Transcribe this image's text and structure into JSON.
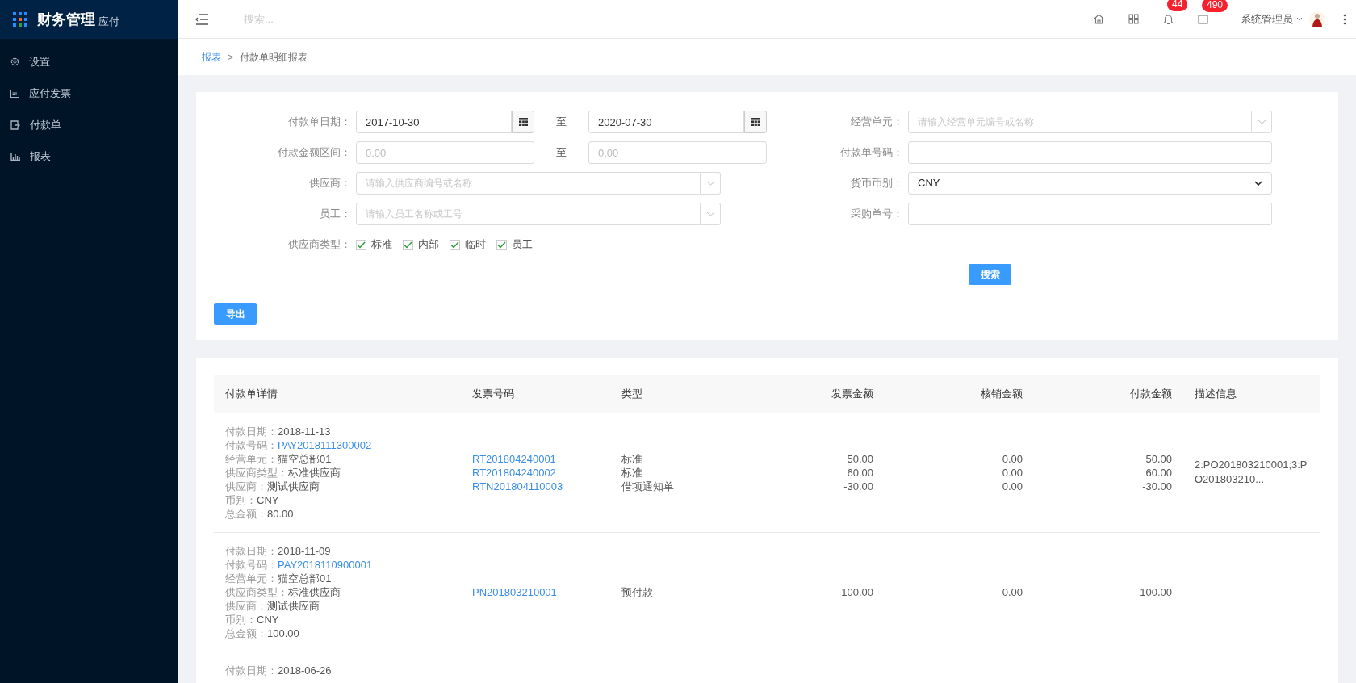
{
  "sidebar": {
    "brand": "财务管理",
    "brand_sub": "应付",
    "items": [
      {
        "label": "设置",
        "selected": false
      },
      {
        "label": "应付发票",
        "selected": false
      },
      {
        "label": "付款单",
        "selected": false
      },
      {
        "label": "报表",
        "selected": false
      }
    ]
  },
  "topbar": {
    "search_placeholder": "搜索...",
    "icons": [
      {
        "kind": "home"
      },
      {
        "kind": "grid"
      },
      {
        "kind": "bell",
        "badge": "44"
      },
      {
        "kind": "box",
        "badge": "490"
      }
    ],
    "user": "系统管理员"
  },
  "breadcrumb": {
    "items": [
      {
        "label": "报表",
        "kind": "link"
      },
      {
        "label": "付款单明细报表",
        "kind": "current"
      }
    ],
    "separator": ">"
  },
  "form": {
    "left_rows": [
      {
        "kind": "date_range",
        "label": "付款单日期：",
        "from": "2017-10-30",
        "to": "2020-07-30",
        "separator": "至"
      },
      {
        "kind": "number_range",
        "label": "付款金额区间：",
        "from_placeholder": "0.00",
        "to_placeholder": "0.00",
        "separator": "至"
      },
      {
        "kind": "combo",
        "label": "供应商：",
        "placeholder": "请输入供应商编号或名称"
      },
      {
        "kind": "combo",
        "label": "员工：",
        "placeholder": "请输入员工名称或工号"
      },
      {
        "kind": "checks",
        "label": "供应商类型：",
        "options": [
          {
            "label": "标准",
            "checked": true
          },
          {
            "label": "内部",
            "checked": true
          },
          {
            "label": "临时",
            "checked": true
          },
          {
            "label": "员工",
            "checked": true
          }
        ]
      }
    ],
    "right_rows": [
      {
        "kind": "combo",
        "label": "经营单元：",
        "placeholder": "请输入经营单元编号或名称"
      },
      {
        "kind": "text",
        "label": "付款单号码："
      },
      {
        "kind": "select",
        "label": "货币币别：",
        "value": "CNY"
      },
      {
        "kind": "text",
        "label": "采购单号："
      }
    ],
    "search_button": "搜索",
    "export_button": "导出"
  },
  "table": {
    "columns": [
      "付款单详情",
      "发票号码",
      "类型",
      "发票金额",
      "核销金额",
      "付款金额",
      "描述信息"
    ],
    "rows": [
      {
        "details": [
          {
            "label": "付款日期：",
            "value": "2018-11-13",
            "kind": "text"
          },
          {
            "label": "付款号码：",
            "value": "PAY2018111300002",
            "kind": "link"
          },
          {
            "label": "经营单元：",
            "value": "猫空总部01",
            "kind": "text"
          },
          {
            "label": "供应商类型：",
            "value": "标准供应商",
            "kind": "text"
          },
          {
            "label": "供应商：",
            "value": "测试供应商",
            "kind": "text"
          },
          {
            "label": "币别：",
            "value": "CNY",
            "kind": "text"
          },
          {
            "label": "总金额：",
            "value": "80.00",
            "kind": "text"
          }
        ],
        "invoices": [
          {
            "number": "RT201804240001",
            "type": "标准",
            "invoice_amount": "50.00",
            "writeoff_amount": "0.00",
            "payment_amount": "50.00"
          },
          {
            "number": "RT201804240002",
            "type": "标准",
            "invoice_amount": "60.00",
            "writeoff_amount": "0.00",
            "payment_amount": "60.00"
          },
          {
            "number": "RTN201804110003",
            "type": "借项通知单",
            "invoice_amount": "-30.00",
            "writeoff_amount": "0.00",
            "payment_amount": "-30.00"
          }
        ],
        "description": "2:PO201803210001;3:PO201803210..."
      },
      {
        "details": [
          {
            "label": "付款日期：",
            "value": "2018-11-09",
            "kind": "text"
          },
          {
            "label": "付款号码：",
            "value": "PAY2018110900001",
            "kind": "link"
          },
          {
            "label": "经营单元：",
            "value": "猫空总部01",
            "kind": "text"
          },
          {
            "label": "供应商类型：",
            "value": "标准供应商",
            "kind": "text"
          },
          {
            "label": "供应商：",
            "value": "测试供应商",
            "kind": "text"
          },
          {
            "label": "币别：",
            "value": "CNY",
            "kind": "text"
          },
          {
            "label": "总金额：",
            "value": "100.00",
            "kind": "text"
          }
        ],
        "invoices": [
          {
            "number": "PN201803210001",
            "type": "预付款",
            "invoice_amount": "100.00",
            "writeoff_amount": "0.00",
            "payment_amount": "100.00"
          }
        ]
      },
      {
        "details": [
          {
            "label": "付款日期：",
            "value": "2018-06-26",
            "kind": "text"
          }
        ],
        "invoices": []
      }
    ]
  }
}
